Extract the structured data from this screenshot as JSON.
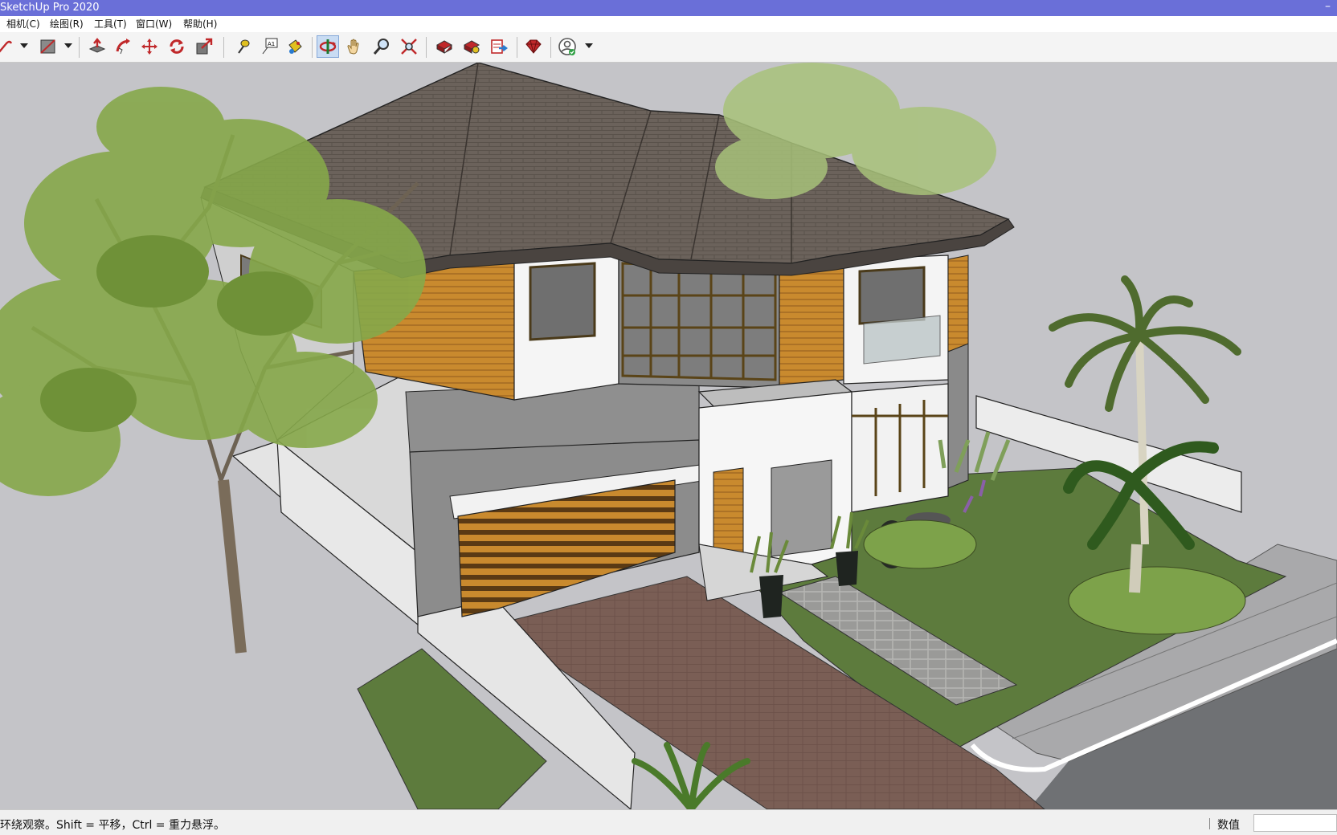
{
  "window": {
    "title": "SketchUp Pro 2020",
    "minimize": "–"
  },
  "menu": [
    {
      "label": "相机(C)"
    },
    {
      "label": "绘图(R)"
    },
    {
      "label": "工具(T)"
    },
    {
      "label": "窗口(W)"
    },
    {
      "label": "帮助(H)"
    }
  ],
  "toolbar": {
    "tools": [
      {
        "icon": "line-draw-icon",
        "dropdown": true
      },
      {
        "icon": "rectangle-icon",
        "dropdown": true
      },
      {
        "icon": "push-pull-icon"
      },
      {
        "icon": "follow-me-icon"
      },
      {
        "icon": "move-icon"
      },
      {
        "icon": "rotate-icon"
      },
      {
        "icon": "scale-icon"
      },
      {
        "icon": "tape-measure-icon"
      },
      {
        "icon": "text-label-icon"
      },
      {
        "icon": "paint-bucket-icon"
      },
      {
        "icon": "orbit-icon",
        "active": true
      },
      {
        "icon": "pan-hand-icon"
      },
      {
        "icon": "zoom-icon"
      },
      {
        "icon": "zoom-extents-icon"
      },
      {
        "icon": "warehouse-icon"
      },
      {
        "icon": "extension-warehouse-icon"
      },
      {
        "icon": "send-to-layout-icon"
      },
      {
        "icon": "ruby-extension-icon"
      },
      {
        "icon": "account-status-icon",
        "dropdown": true
      }
    ]
  },
  "status": {
    "message": "环绕观察。Shift = 平移，Ctrl = 重力悬浮。",
    "measurements_label": "数值",
    "measurements_value": ""
  }
}
